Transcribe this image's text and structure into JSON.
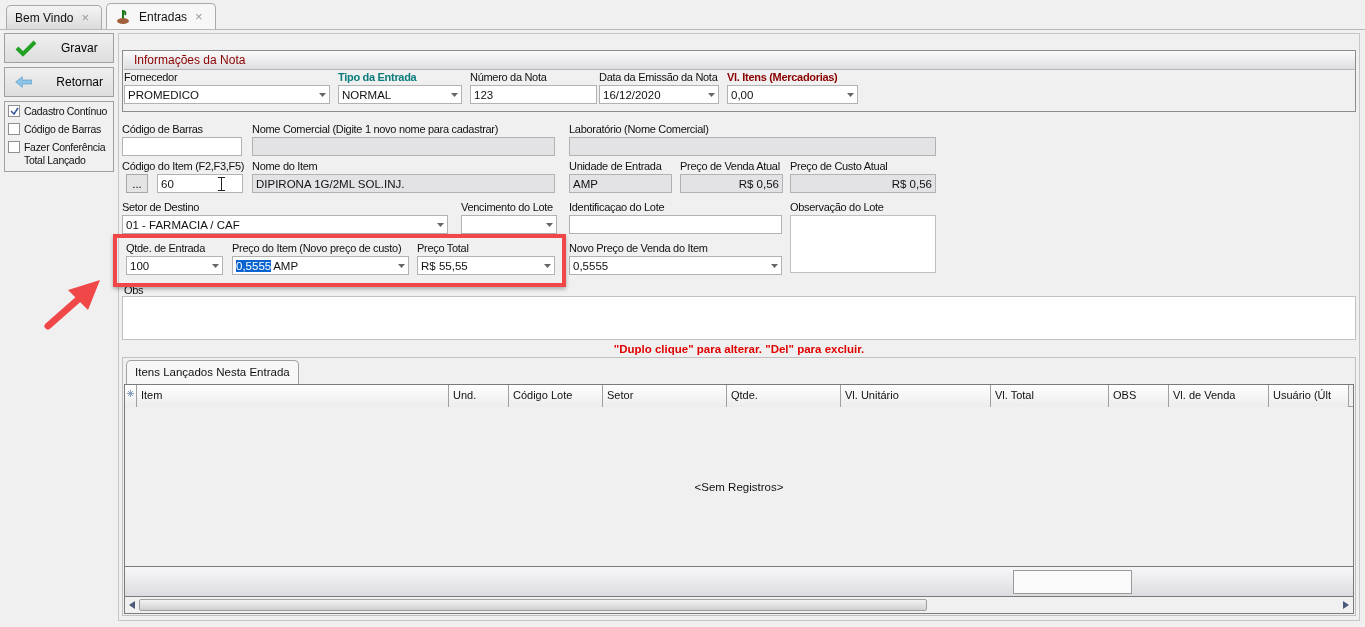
{
  "tabs": [
    {
      "label": "Bem Vindo",
      "selected": false,
      "close": "×"
    },
    {
      "label": "Entradas",
      "selected": true,
      "close": "×"
    }
  ],
  "sidebar": {
    "buttons": [
      {
        "label": "Gravar",
        "kind": "save"
      },
      {
        "label": "Retornar",
        "kind": "back"
      }
    ],
    "options": [
      {
        "label": "Cadastro Contínuo",
        "checked": true
      },
      {
        "label": "Código de Barras",
        "checked": false
      },
      {
        "label": "Fazer Conferência Total Lançado",
        "checked": false
      }
    ]
  },
  "nota": {
    "title": "Informações da Nota",
    "fields": [
      {
        "label": "Fornecedor",
        "value": "PROMEDICO",
        "kind": "dropdown"
      },
      {
        "label": "Tipo da Entrada",
        "value": "NORMAL",
        "kind": "dropdown",
        "color": "#0a7c7c"
      },
      {
        "label": "Número da Nota",
        "value": "123",
        "kind": "text"
      },
      {
        "label": "Data da Emissão da Nota",
        "value": "16/12/2020",
        "kind": "dropdown"
      },
      {
        "label": "Vl. Itens (Mercadorias)",
        "value": "0,00",
        "kind": "dropdown",
        "color": "#8b0000"
      }
    ]
  },
  "form": {
    "fields": [
      {
        "label": "Código de Barras",
        "kind": "text"
      },
      {
        "label": "Nome Comercial (Digite 1 novo nome para cadastrar)",
        "kind": "readonly"
      },
      {
        "label": "Laboratório (Nome Comercial)",
        "kind": "readonly"
      },
      {
        "label": "Código do Item (F2,F3,F5)",
        "button": "...",
        "value": "60",
        "kind": "text",
        "cursor": true
      },
      {
        "label": "Nome do Item",
        "value": "DIPIRONA 1G/2ML SOL.INJ.",
        "kind": "readonly"
      },
      {
        "label": "Unidade de Entrada",
        "value": "AMP",
        "kind": "readonly"
      },
      {
        "label": "Preço de Venda Atual",
        "value": "R$ 0,56",
        "kind": "readonly"
      },
      {
        "label": "Preço de Custo Atual",
        "value": "R$ 0,56",
        "kind": "readonly"
      },
      {
        "label": "Setor de Destino",
        "value": "01 - FARMACIA / CAF",
        "kind": "dropdown"
      },
      {
        "label": "Vencimento do Lote",
        "kind": "dropdown"
      },
      {
        "label": "Identificaçao do Lote",
        "kind": "text"
      },
      {
        "label": "Observação do Lote",
        "kind": "memo"
      },
      {
        "label": "Qtde. de Entrada",
        "value": "100",
        "kind": "dropdown"
      },
      {
        "label": "Preço do Item (Novo preço de custo)",
        "selected_value": "0,5555",
        "value": "AMP",
        "kind": "dropdown"
      },
      {
        "label": "Preço Total",
        "value": "R$ 55,55",
        "kind": "dropdown"
      },
      {
        "label": "Novo Preço de Venda do Item",
        "value": "0,5555",
        "kind": "dropdown"
      }
    ],
    "obs_label": "Obs"
  },
  "hint": "\"Duplo clique\" para alterar. \"Del\" para excluir.",
  "grid": {
    "tab": "Itens Lançados Nesta Entrada",
    "columns": [
      "Item",
      "Und.",
      "Código Lote",
      "Setor",
      "Qtde.",
      "Vl. Unitário",
      "Vl. Total",
      "OBS",
      "Vl. de Venda",
      "Usuário (Últ"
    ],
    "empty": "<Sem Registros>"
  }
}
